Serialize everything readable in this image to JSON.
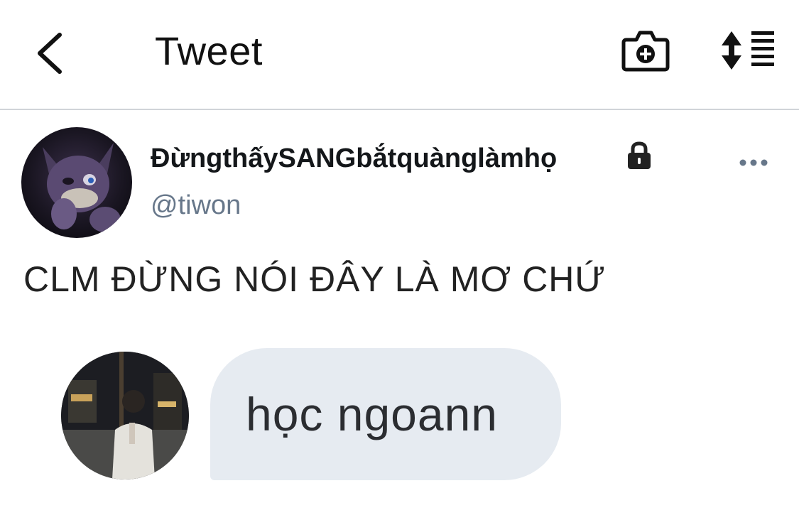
{
  "header": {
    "title": "Tweet",
    "back_icon": "chevron-left-icon",
    "camera_icon": "camera-plus-icon",
    "sort_icon": "sort-list-icon"
  },
  "tweet": {
    "author": {
      "display_name": "ĐừngthấySANGbắtquànglàmhọ",
      "handle": "@tiwon",
      "protected_icon": "lock-icon"
    },
    "more_icon": "more-dots-icon",
    "text": "CLM ĐỪNG NÓI ĐÂY LÀ MƠ CHỨ",
    "media": {
      "bubble_text": "học ngoann"
    }
  },
  "colors": {
    "text_primary": "#14171a",
    "text_secondary": "#67778a",
    "divider": "#d0d4d8",
    "bubble_bg": "#e6ebf1"
  }
}
